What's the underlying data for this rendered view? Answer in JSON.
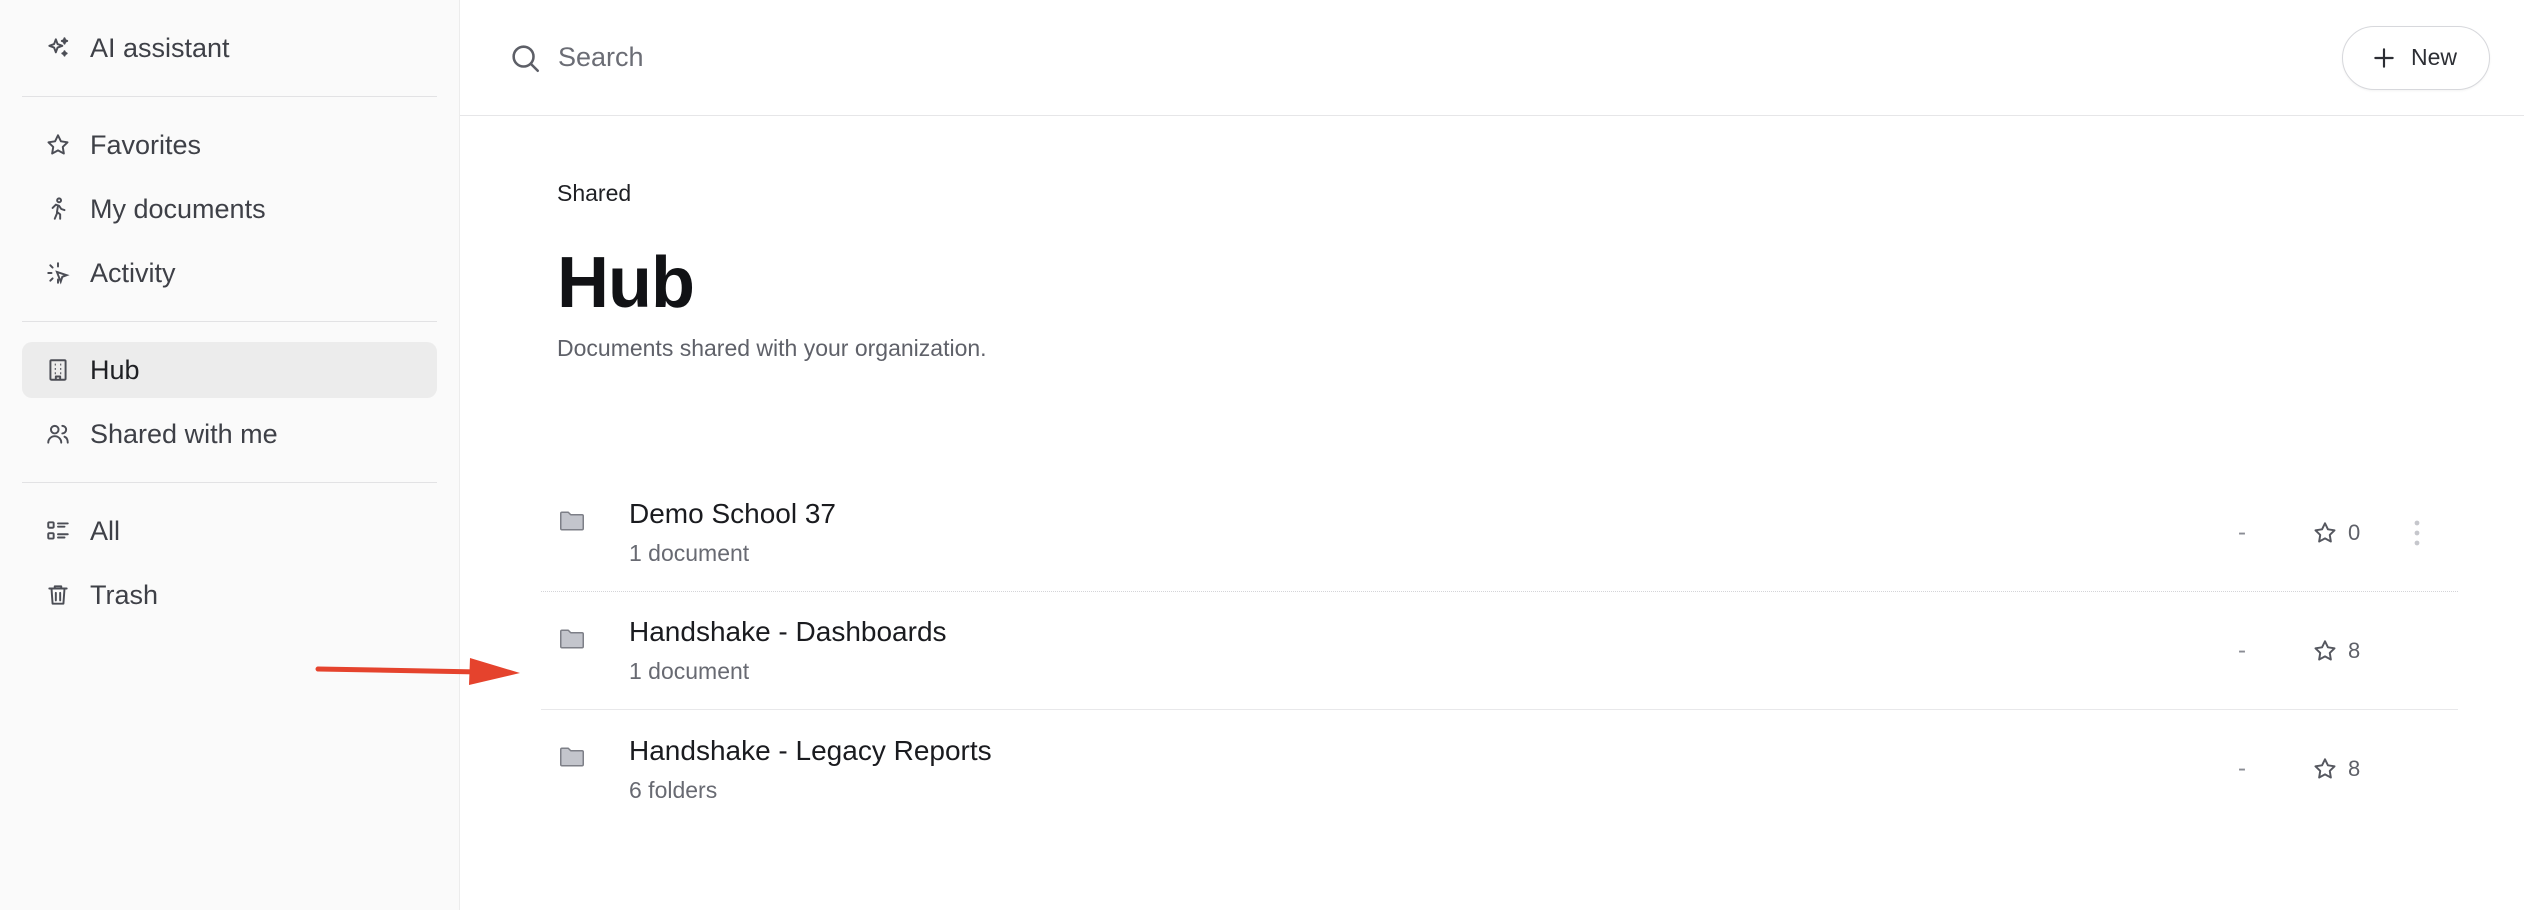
{
  "sidebar": {
    "ai_assistant": "AI assistant",
    "items_primary": [
      {
        "label": "Favorites",
        "icon": "star-icon"
      },
      {
        "label": "My documents",
        "icon": "walking-person-icon"
      },
      {
        "label": "Activity",
        "icon": "activity-icon"
      }
    ],
    "items_shared": [
      {
        "label": "Hub",
        "icon": "building-icon",
        "active": true
      },
      {
        "label": "Shared with me",
        "icon": "users-icon"
      }
    ],
    "items_other": [
      {
        "label": "All",
        "icon": "list-icon"
      },
      {
        "label": "Trash",
        "icon": "trash-icon"
      }
    ]
  },
  "topbar": {
    "search_placeholder": "Search",
    "new_label": "New"
  },
  "page": {
    "breadcrumb": "Shared",
    "title": "Hub",
    "subtitle": "Documents shared with your organization."
  },
  "rows": [
    {
      "title": "Demo School 37",
      "meta": "1 document",
      "dash": "-",
      "stars": "0"
    },
    {
      "title": "Handshake - Dashboards",
      "meta": "1 document",
      "dash": "-",
      "stars": "8"
    },
    {
      "title": "Handshake - Legacy Reports",
      "meta": "6 folders",
      "dash": "-",
      "stars": "8"
    }
  ],
  "colors": {
    "sidebar_bg": "#fafafa",
    "active_bg": "#ececec",
    "arrow": "#e5432d"
  }
}
